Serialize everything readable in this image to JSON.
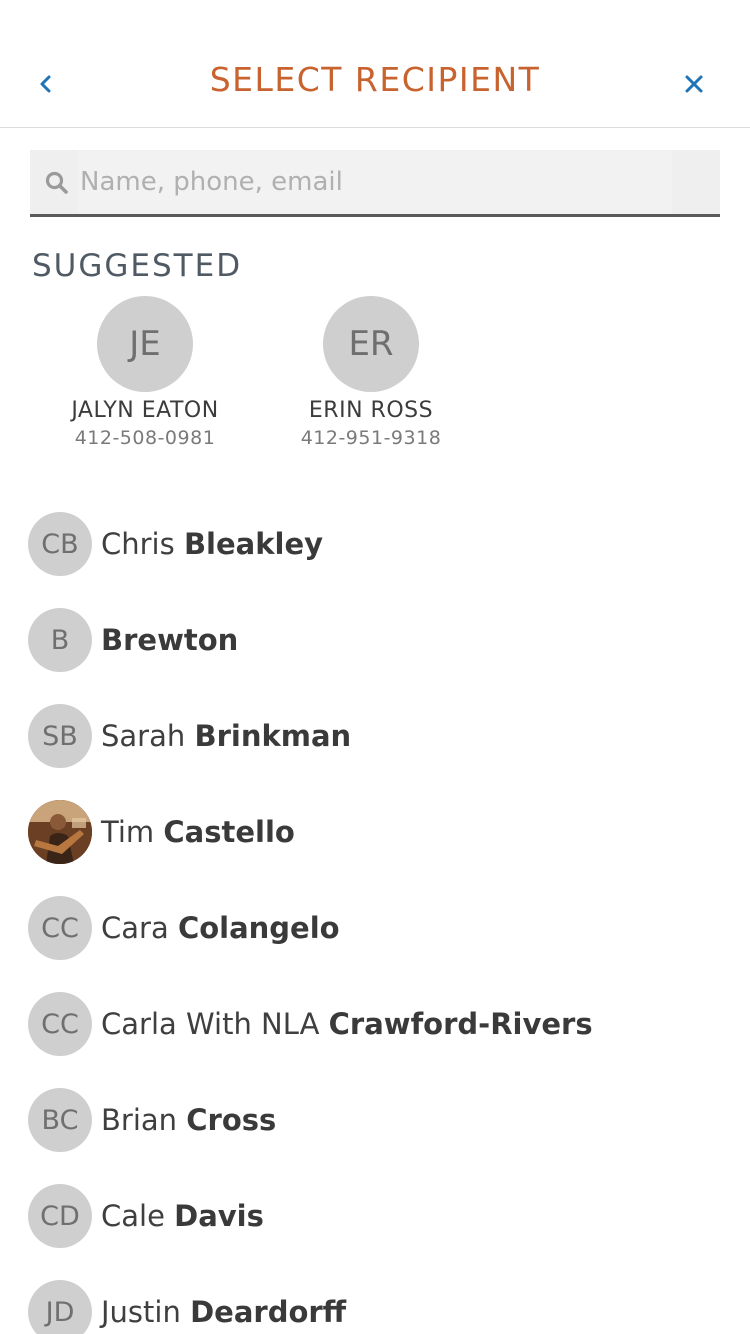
{
  "header": {
    "title": "SELECT RECIPIENT",
    "back_icon": "chevron-left-icon",
    "close_icon": "close-icon",
    "accent_color": "#c8622e",
    "icon_color": "#1f73b7"
  },
  "search": {
    "placeholder": "Name, phone, email",
    "value": ""
  },
  "suggested": {
    "heading": "SUGGESTED",
    "items": [
      {
        "initials": "JE",
        "name": "JALYN EATON",
        "phone": "412-508-0981"
      },
      {
        "initials": "ER",
        "name": "ERIN ROSS",
        "phone": "412-951-9318"
      }
    ]
  },
  "contacts": [
    {
      "initials": "CB",
      "first": "Chris",
      "last": "Bleakley",
      "photo": false
    },
    {
      "initials": "B",
      "first": "",
      "last": "Brewton",
      "photo": false
    },
    {
      "initials": "SB",
      "first": "Sarah",
      "last": "Brinkman",
      "photo": false
    },
    {
      "initials": "",
      "first": "Tim",
      "last": "Castello",
      "photo": true
    },
    {
      "initials": "CC",
      "first": "Cara",
      "last": "Colangelo",
      "photo": false
    },
    {
      "initials": "CC",
      "first": "Carla With NLA",
      "last": "Crawford-Rivers",
      "photo": false
    },
    {
      "initials": "BC",
      "first": "Brian",
      "last": "Cross",
      "photo": false
    },
    {
      "initials": "CD",
      "first": "Cale",
      "last": "Davis",
      "photo": false
    },
    {
      "initials": "JD",
      "first": "Justin",
      "last": "Deardorff",
      "photo": false
    }
  ]
}
